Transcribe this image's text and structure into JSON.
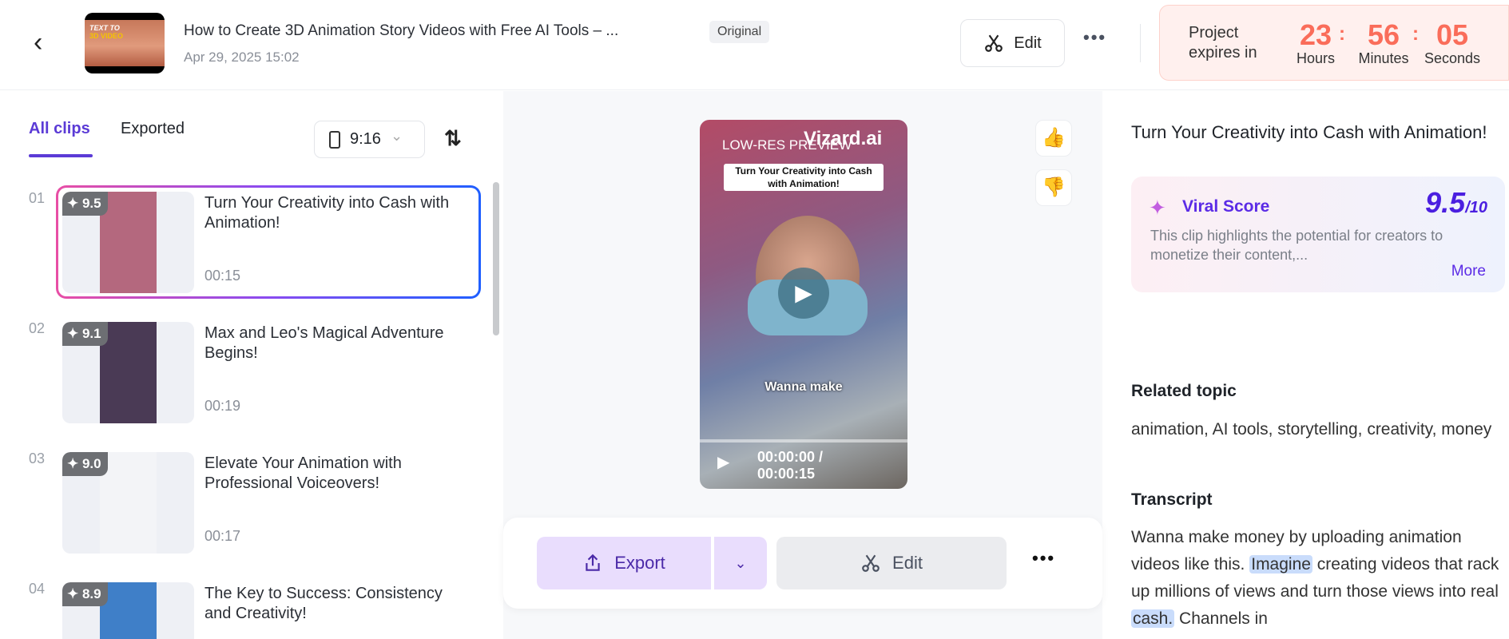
{
  "header": {
    "back_icon": "chevron-left-icon",
    "project_title": "How to Create 3D Animation Story Videos with Free AI Tools – ...",
    "thumbnail_text": [
      "TEXT TO",
      "3D VIDEO"
    ],
    "date": "Apr 29, 2025 15:02",
    "badge": "Original",
    "edit_label": "Edit",
    "more_label": "•••",
    "expire": {
      "label": "Project expires in",
      "hours": "23",
      "minutes": "56",
      "seconds": "05",
      "hours_label": "Hours",
      "minutes_label": "Minutes",
      "seconds_label": "Seconds",
      "colon": ":"
    }
  },
  "left": {
    "tabs": [
      {
        "label": "All clips",
        "active": true
      },
      {
        "label": "Exported",
        "active": false
      }
    ],
    "ratio": "9:16",
    "ratio_chevron": "⌄",
    "sort_icon": "⇅",
    "clips": [
      {
        "num": "01",
        "score": "9.5",
        "title": "Turn Your Creativity into Cash with Animation!",
        "duration": "00:15",
        "selected": true,
        "color": "#b4687e"
      },
      {
        "num": "02",
        "score": "9.1",
        "title": "Max and Leo's Magical Adventure Begins!",
        "duration": "00:19",
        "selected": false,
        "color": "#4a3a55"
      },
      {
        "num": "03",
        "score": "9.0",
        "title": "Elevate Your Animation with Professional Voiceovers!",
        "duration": "00:17",
        "selected": false,
        "color": "#f3f4f7"
      },
      {
        "num": "04",
        "score": "8.9",
        "title": "The Key to Success: Consistency and Creativity!",
        "duration": "",
        "selected": false,
        "color": "#3f7fc8"
      }
    ]
  },
  "center": {
    "video": {
      "lowres": "LOW-RES PREVIEW",
      "watermark": "Vizard.ai",
      "caption": "Turn Your Creativity into Cash with Animation!",
      "subtitle": "Wanna make",
      "time": "00:00:00 /",
      "duration": "00:00:15",
      "progress": 0
    },
    "thumbs_up": "👍",
    "thumbs_down": "👎",
    "export_label": "Export",
    "export_chevron": "⌄",
    "edit_label": "Edit",
    "more_label": "•••"
  },
  "right": {
    "title": "Turn Your Creativity into Cash with Animation!",
    "viral": {
      "label": "Viral Score",
      "score": "9.5",
      "out_of": "/10",
      "desc": "This clip highlights the potential for creators to monetize their content,...",
      "more": "More"
    },
    "related_heading": "Related topic",
    "related": "animation, AI tools, storytelling, creativity, money",
    "transcript_heading": "Transcript",
    "transcript": [
      "Wanna make money by uploading animation videos like this. ",
      "Imagine",
      " creating videos that rack up millions of views and turn those views into real ",
      "cash.",
      " Channels in"
    ]
  },
  "colors": {
    "accent": "#5b3bd6",
    "expire": "#fa6d5a",
    "export_bg": "#e9ddfd"
  }
}
